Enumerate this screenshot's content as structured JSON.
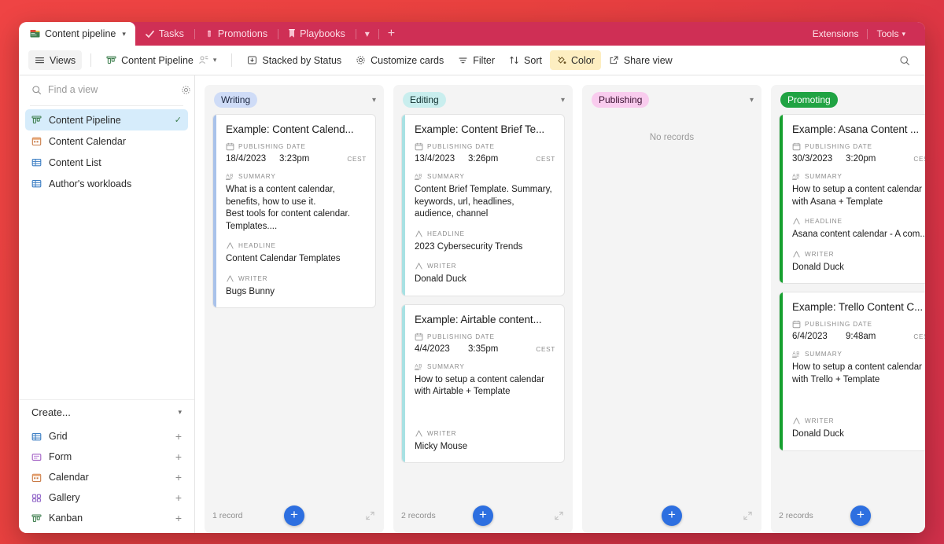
{
  "window": {
    "tabs": [
      {
        "label": "Content pipeline",
        "icon": "book-stack-icon",
        "active": true,
        "has_chevron": true
      },
      {
        "label": "Tasks",
        "icon": "check-icon",
        "active": false
      },
      {
        "label": "Promotions",
        "icon": "megaphone-icon",
        "active": false
      },
      {
        "label": "Playbooks",
        "icon": "bookmark-icon",
        "active": false
      }
    ],
    "tab_overflow_icon": "chevron-down-icon",
    "tab_add_icon": "plus-icon",
    "right_items": [
      {
        "label": "Extensions",
        "name": "extensions-button"
      },
      {
        "label": "Tools",
        "name": "tools-button",
        "chevron": true
      }
    ]
  },
  "toolbar": {
    "views_label": "Views",
    "current_view": "Content Pipeline",
    "stacked_label": "Stacked by Status",
    "customize_label": "Customize cards",
    "filter_label": "Filter",
    "sort_label": "Sort",
    "color_label": "Color",
    "share_label": "Share view",
    "search_icon": "search-icon",
    "color_accent": "#fdeec1"
  },
  "sidebar": {
    "search": {
      "placeholder": "Find a view",
      "value": ""
    },
    "settings_icon": "gear-icon",
    "views": [
      {
        "label": "Content Pipeline",
        "icon": "kanban-icon",
        "active": true,
        "checked": true
      },
      {
        "label": "Content Calendar",
        "icon": "calendar-icon",
        "active": false
      },
      {
        "label": "Content List",
        "icon": "grid-icon",
        "active": false
      },
      {
        "label": "Author's workloads",
        "icon": "grid-icon",
        "active": false
      }
    ],
    "create": {
      "header": "Create...",
      "items": [
        {
          "label": "Grid",
          "icon": "grid-icon"
        },
        {
          "label": "Form",
          "icon": "form-icon"
        },
        {
          "label": "Calendar",
          "icon": "calendar-icon"
        },
        {
          "label": "Gallery",
          "icon": "gallery-icon"
        },
        {
          "label": "Kanban",
          "icon": "kanban-icon"
        }
      ]
    }
  },
  "field_labels": {
    "publishing_date": "PUBLISHING DATE",
    "summary": "SUMMARY",
    "headline": "HEADLINE",
    "writer": "WRITER"
  },
  "board": {
    "columns": [
      {
        "name": "Writing",
        "badge_bg": "#cfdcf7",
        "badge_fg": "#1c2740",
        "stripe": "#a9c2ea",
        "record_count": "1 record",
        "empty_text": "",
        "cards": [
          {
            "title": "Example: Content Calend...",
            "date": "18/4/2023",
            "time": "3:23pm",
            "tz": "CEST",
            "summary": "What is a content calendar, benefits, how to use it.\nBest tools for content calendar. Templates....",
            "headline": "Content Calendar Templates",
            "writer": "Bugs Bunny"
          }
        ]
      },
      {
        "name": "Editing",
        "badge_bg": "#c9eeee",
        "badge_fg": "#10302f",
        "stripe": "#a8e1e3",
        "record_count": "2 records",
        "empty_text": "",
        "cards": [
          {
            "title": "Example: Content Brief Te...",
            "date": "13/4/2023",
            "time": "3:26pm",
            "tz": "CEST",
            "summary": "Content Brief Template. Summary, keywords, url, headlines, audience, channel",
            "headline": "2023 Cybersecurity Trends",
            "writer": "Donald Duck"
          },
          {
            "title": "Example: Airtable content...",
            "date": "4/4/2023",
            "time": "3:35pm",
            "tz": "CEST",
            "summary": "How to setup a content calendar with Airtable + Template",
            "headline": "",
            "writer": "Micky Mouse"
          }
        ]
      },
      {
        "name": "Publishing",
        "badge_bg": "#f9ccee",
        "badge_fg": "#3a0f30",
        "stripe": "#f1a9dd",
        "record_count": "",
        "empty_text": "No records",
        "cards": []
      },
      {
        "name": "Promoting",
        "badge_bg": "#20a343",
        "badge_fg": "#ffffff",
        "stripe": "#16a02f",
        "record_count": "2 records",
        "empty_text": "",
        "cards": [
          {
            "title": "Example: Asana Content ...",
            "date": "30/3/2023",
            "time": "3:20pm",
            "tz": "CEST",
            "summary": "How to setup a content calendar with Asana + Template",
            "headline": "Asana content calendar - A com...",
            "writer": "Donald Duck"
          },
          {
            "title": "Example: Trello Content C...",
            "date": "6/4/2023",
            "time": "9:48am",
            "tz": "CEST",
            "summary": "How to setup a content calendar with Trello + Template",
            "headline": "",
            "writer": "Donald Duck"
          }
        ]
      }
    ],
    "add_record_icon": "plus-icon",
    "expand_icon": "expand-icon"
  }
}
